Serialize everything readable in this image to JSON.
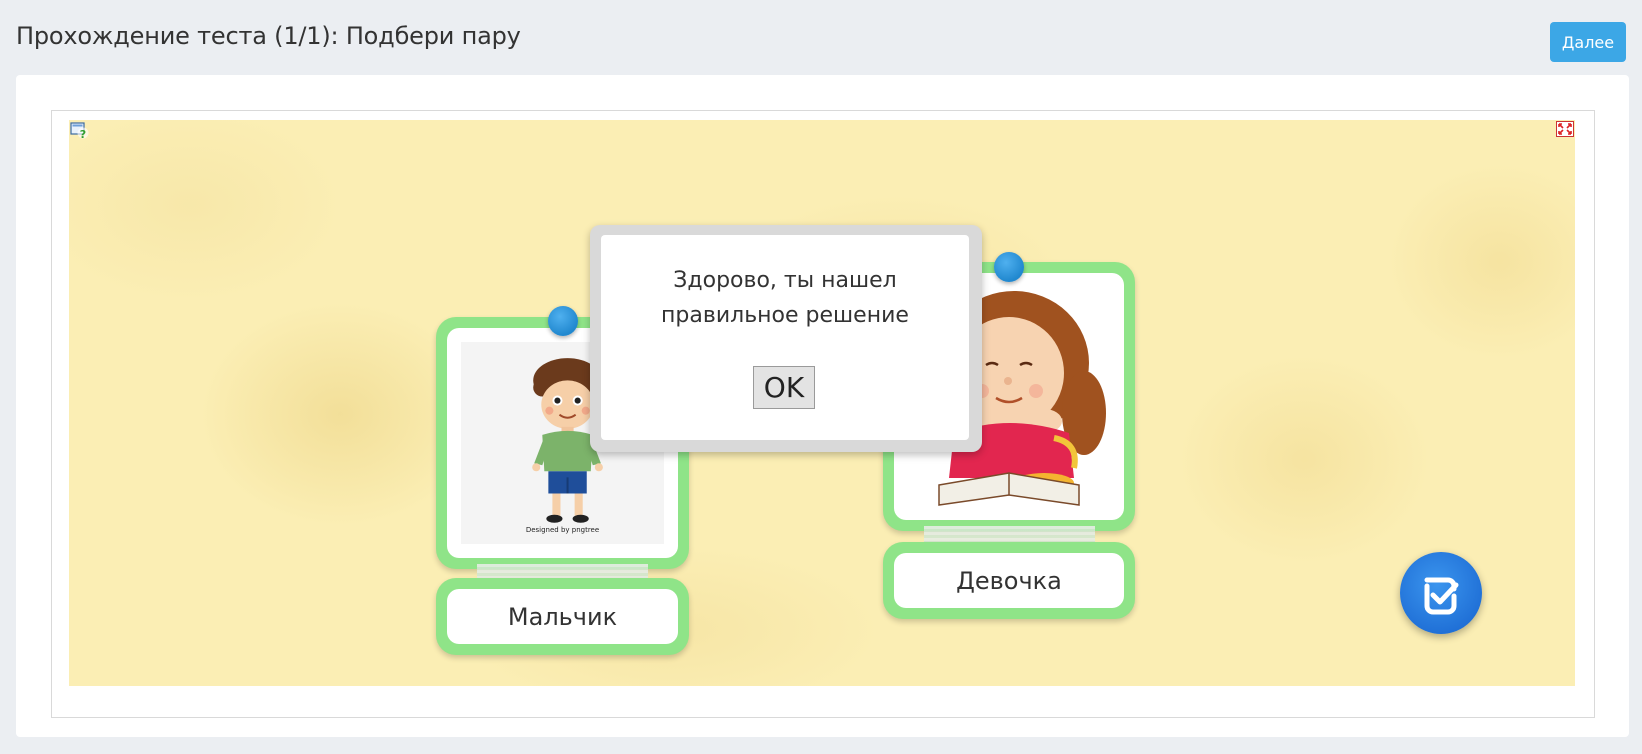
{
  "header": {
    "title": "Прохождение теста (1/1): Подбери пару",
    "next_label": "Далее"
  },
  "cards": [
    {
      "label": "Мальчик",
      "credit": "Designed by pngtree"
    },
    {
      "label": "Девочка"
    }
  ],
  "dialog": {
    "message_line1": "Здорово, ты нашел",
    "message_line2": "правильное решение",
    "ok_label": "OK"
  },
  "colors": {
    "accent": "#3ca7e6",
    "card_border": "#8fe488",
    "pin": "#2188cf",
    "stage": "#fbeeb4",
    "check_button": "#1f6fd6"
  },
  "icons": {
    "help": "help-icon",
    "fullscreen": "fullscreen-icon",
    "check": "check-icon"
  }
}
